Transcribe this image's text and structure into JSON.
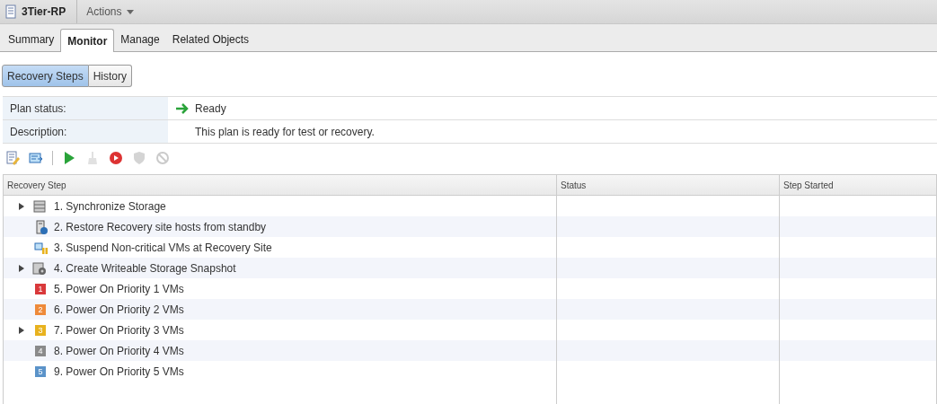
{
  "header": {
    "title": "3Tier-RP",
    "actions": "Actions"
  },
  "tabs": [
    {
      "label": "Summary",
      "selected": false
    },
    {
      "label": "Monitor",
      "selected": true
    },
    {
      "label": "Manage",
      "selected": false
    },
    {
      "label": "Related Objects",
      "selected": false
    }
  ],
  "views": [
    {
      "label": "Recovery Steps",
      "selected": true
    },
    {
      "label": "History",
      "selected": false
    }
  ],
  "info": [
    {
      "label": "Plan status:",
      "value": "Ready",
      "kind": "status"
    },
    {
      "label": "Description:",
      "value": "This plan is ready for test or recovery.",
      "kind": "text"
    }
  ],
  "toolbar": [
    [
      {
        "kind": "edit",
        "disabled": false
      },
      {
        "kind": "run",
        "disabled": false
      }
    ],
    [
      {
        "kind": "play",
        "disabled": false
      },
      {
        "kind": "cleanup",
        "disabled": true
      },
      {
        "kind": "stop",
        "disabled": false
      },
      {
        "kind": "shield",
        "disabled": true
      },
      {
        "kind": "cancel",
        "disabled": true
      }
    ]
  ],
  "table": {
    "columns": [
      "Recovery Step",
      "Status",
      "Step Started"
    ],
    "rows": [
      {
        "label": "1. Synchronize Storage",
        "kind": "storage",
        "expandable": true
      },
      {
        "label": "2. Restore Recovery site hosts from standby",
        "kind": "host",
        "expandable": false
      },
      {
        "label": "3. Suspend Non-critical VMs at Recovery Site",
        "kind": "suspend",
        "expandable": false
      },
      {
        "label": "4. Create Writeable Storage Snapshot",
        "kind": "snapshot",
        "expandable": true
      },
      {
        "label": "5. Power On Priority 1 VMs",
        "kind": "priority",
        "badge": "1",
        "color": "#d9393b",
        "expandable": false
      },
      {
        "label": "6. Power On Priority 2 VMs",
        "kind": "priority",
        "badge": "2",
        "color": "#ee8a3a",
        "expandable": false
      },
      {
        "label": "7. Power On Priority 3 VMs",
        "kind": "priority",
        "badge": "3",
        "color": "#e8b21e",
        "expandable": true
      },
      {
        "label": "8. Power On Priority 4 VMs",
        "kind": "priority",
        "badge": "4",
        "color": "#8a8a8a",
        "expandable": false
      },
      {
        "label": "9. Power On Priority 5 VMs",
        "kind": "priority",
        "badge": "5",
        "color": "#5b93c9",
        "expandable": false
      }
    ]
  }
}
